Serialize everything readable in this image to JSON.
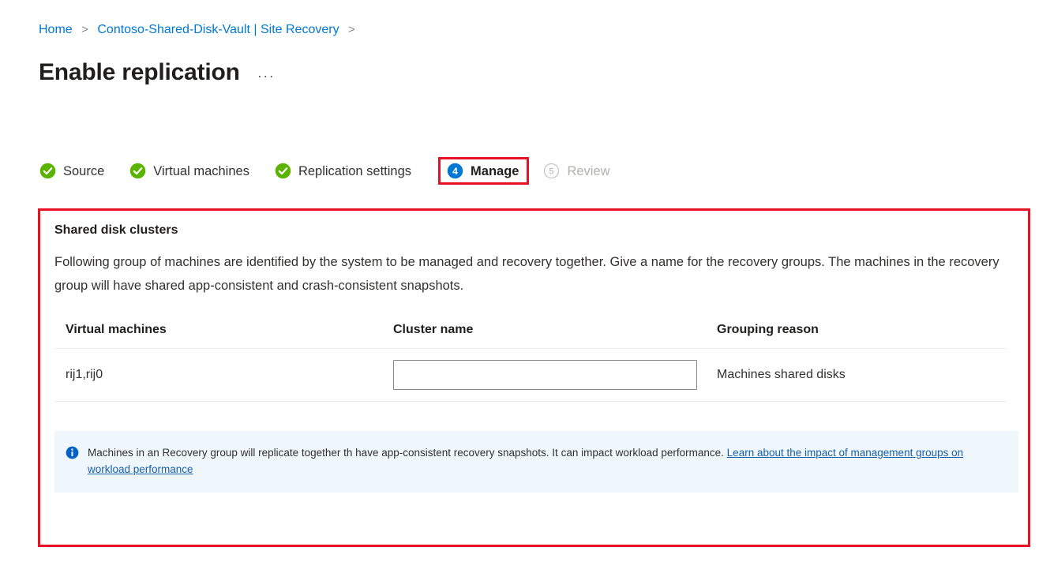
{
  "breadcrumb": {
    "items": [
      {
        "label": "Home"
      },
      {
        "label": "Contoso-Shared-Disk-Vault | Site Recovery"
      }
    ],
    "separator": ">"
  },
  "header": {
    "title": "Enable replication",
    "more_actions": "···"
  },
  "wizard": {
    "steps": [
      {
        "label": "Source",
        "state": "done",
        "icon": "check-circle-icon",
        "marker": ""
      },
      {
        "label": "Virtual machines",
        "state": "done",
        "icon": "check-circle-icon",
        "marker": ""
      },
      {
        "label": "Replication settings",
        "state": "done",
        "icon": "check-circle-icon",
        "marker": ""
      },
      {
        "label": "Manage",
        "state": "current",
        "icon": "step-number-icon",
        "marker": "4"
      },
      {
        "label": "Review",
        "state": "disabled",
        "icon": "step-number-icon",
        "marker": "5"
      }
    ]
  },
  "panel": {
    "heading": "Shared disk clusters",
    "description": "Following group of machines are identified by the system to be managed and recovery together. Give a name for the recovery groups. The machines in the recovery group will have shared app-consistent and crash-consistent snapshots.",
    "table": {
      "columns": [
        "Virtual machines",
        "Cluster name",
        "Grouping reason"
      ],
      "rows": [
        {
          "virtual_machines": "rij1,rij0",
          "cluster_name_value": "",
          "cluster_name_placeholder": "",
          "grouping_reason": "Machines shared disks"
        }
      ]
    },
    "info": {
      "icon": "info-circle-icon",
      "text": "Machines in an Recovery group will replicate together th have app-consistent recovery snapshots. It can impact workload performance. ",
      "link_text": "Learn about the impact of management groups on workload performance"
    }
  },
  "colors": {
    "accent_blue": "#0078d4",
    "success_green": "#57a300",
    "highlight_red": "#e81123",
    "info_background": "#eff6fc",
    "disabled_gray": "#b3b0ad"
  }
}
